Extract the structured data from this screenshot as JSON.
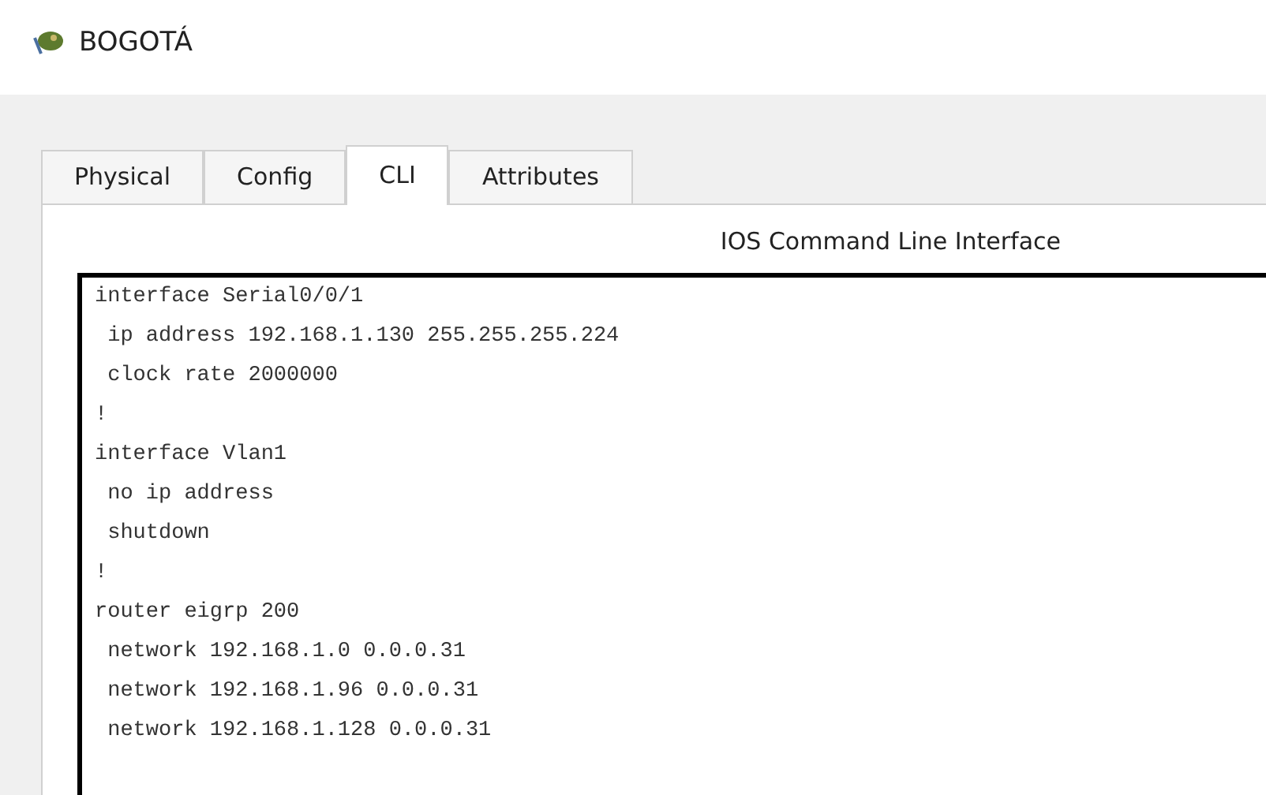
{
  "window": {
    "title": "BOGOTÁ"
  },
  "tabs": [
    {
      "label": "Physical",
      "selected": false
    },
    {
      "label": "Config",
      "selected": false
    },
    {
      "label": "CLI",
      "selected": true
    },
    {
      "label": "Attributes",
      "selected": false
    }
  ],
  "cli": {
    "heading": "IOS Command Line Interface",
    "lines": [
      "interface Serial0/0/1",
      " ip address 192.168.1.130 255.255.255.224",
      " clock rate 2000000",
      "!",
      "interface Vlan1",
      " no ip address",
      " shutdown",
      "!",
      "router eigrp 200",
      " network 192.168.1.0 0.0.0.31",
      " network 192.168.1.96 0.0.0.31",
      " network 192.168.1.128 0.0.0.31"
    ]
  }
}
